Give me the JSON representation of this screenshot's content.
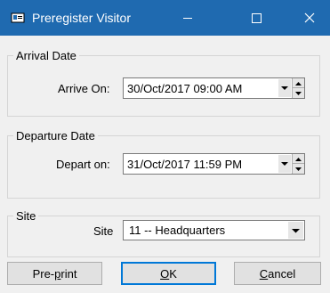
{
  "window": {
    "title": "Preregister Visitor",
    "title_icon": "visitor-card-icon",
    "controls": [
      "minimize-icon",
      "maximize-icon",
      "close-icon"
    ],
    "titlebar_color": "#1f6ab0"
  },
  "arrival": {
    "group_label": "Arrival Date",
    "field_label": "Arrive On:",
    "value": "30/Oct/2017 09:00 AM"
  },
  "departure": {
    "group_label": "Departure Date",
    "field_label": "Depart on:",
    "value": "31/Oct/2017 11:59 PM"
  },
  "site": {
    "group_label": "Site",
    "field_label": "Site",
    "selected": "11 -- Headquarters"
  },
  "buttons": {
    "preprint_pre": "Pre",
    "preprint_mid": "-p",
    "preprint_post": "rint",
    "ok_accel": "O",
    "ok_rest": "K",
    "cancel_accel": "C",
    "cancel_rest": "ancel"
  }
}
